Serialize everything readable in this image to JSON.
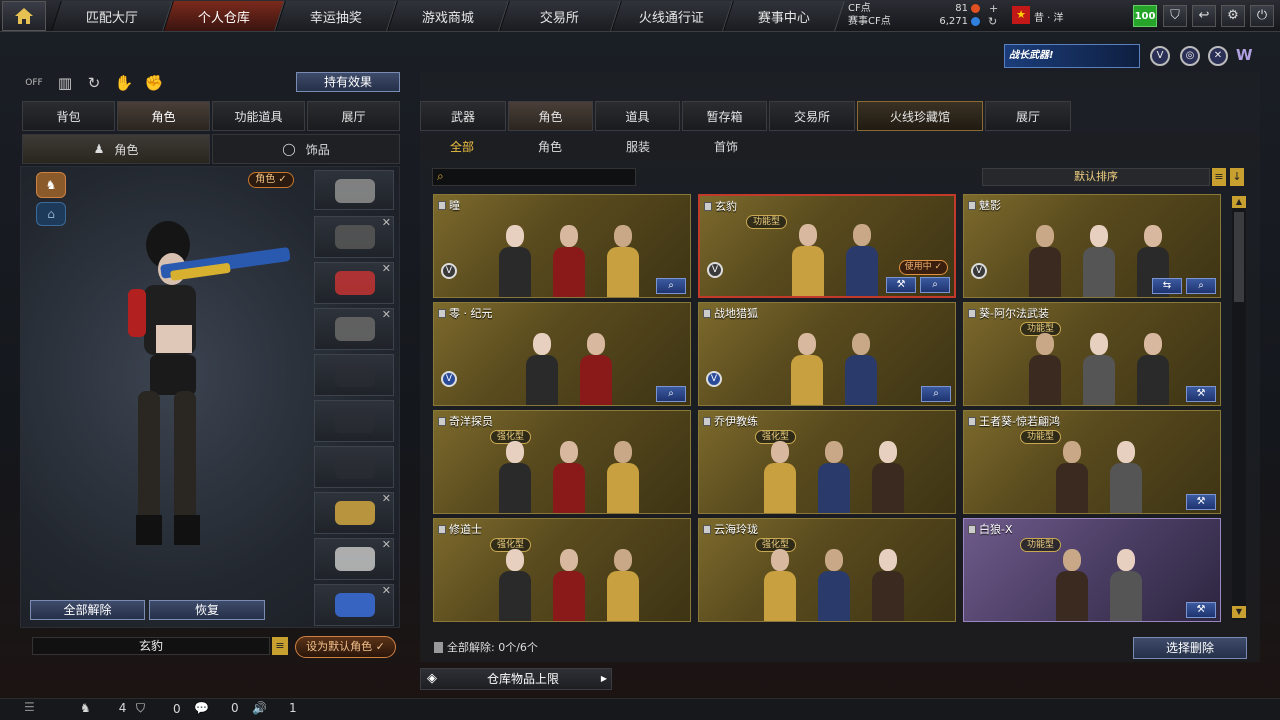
{
  "nav": {
    "tabs": [
      "匹配大厅",
      "个人仓库",
      "幸运抽奖",
      "游戏商城",
      "交易所",
      "火线通行证",
      "赛事中心"
    ],
    "active_index": 1,
    "cf_label": "CF点",
    "cf_value": "81",
    "event_cf_label": "赛事CF点",
    "event_cf_value": "6,271",
    "user_name": "昔 · 洋",
    "level": "100"
  },
  "events": {
    "banner_text": "战长武器!"
  },
  "left": {
    "effects_button": "持有效果",
    "tabs": [
      "背包",
      "角色",
      "功能道具",
      "展厅"
    ],
    "active_tab": 1,
    "subtabs": [
      "角色",
      "饰品"
    ],
    "role_tag": "角色 ✓",
    "unequip_all": "全部解除",
    "restore": "恢复",
    "current_role": "玄豹",
    "set_default": "设为默认角色 ✓"
  },
  "right": {
    "tabs": [
      "武器",
      "角色",
      "道具",
      "暂存箱",
      "交易所",
      "火线珍藏馆",
      "展厅"
    ],
    "active_tab": 1,
    "subtabs": [
      "全部",
      "角色",
      "服装",
      "首饰"
    ],
    "active_subtab": 0,
    "sort_label": "默认排序",
    "bottom_text": "全部解除: 0个/6个",
    "delete_button": "选择删除",
    "storage_limit": "仓库物品上限"
  },
  "cards": [
    {
      "name": "瞳",
      "badge": ""
    },
    {
      "name": "玄豹",
      "badge": "功能型",
      "status": "使用中 ✓"
    },
    {
      "name": "魅影",
      "badge": ""
    },
    {
      "name": "零 · 纪元",
      "badge": ""
    },
    {
      "name": "战地猎狐",
      "badge": ""
    },
    {
      "name": "葵-阿尔法武装",
      "badge": "功能型"
    },
    {
      "name": "奇洋探员",
      "badge": "强化型"
    },
    {
      "name": "乔伊教练",
      "badge": "强化型"
    },
    {
      "name": "王者葵-惊若翩鸿",
      "badge": "功能型"
    },
    {
      "name": "修道士",
      "badge": "强化型"
    },
    {
      "name": "云海玲珑",
      "badge": "强化型"
    },
    {
      "name": "白狼-X",
      "badge": "功能型"
    }
  ],
  "status_bar": {
    "count_a": "4",
    "count_b": "0",
    "count_c": "0",
    "count_d": "1"
  },
  "colors": {
    "accent_gold": "#c8a030",
    "active_tab": "#7a2a1c",
    "button_blue": "#253049"
  }
}
